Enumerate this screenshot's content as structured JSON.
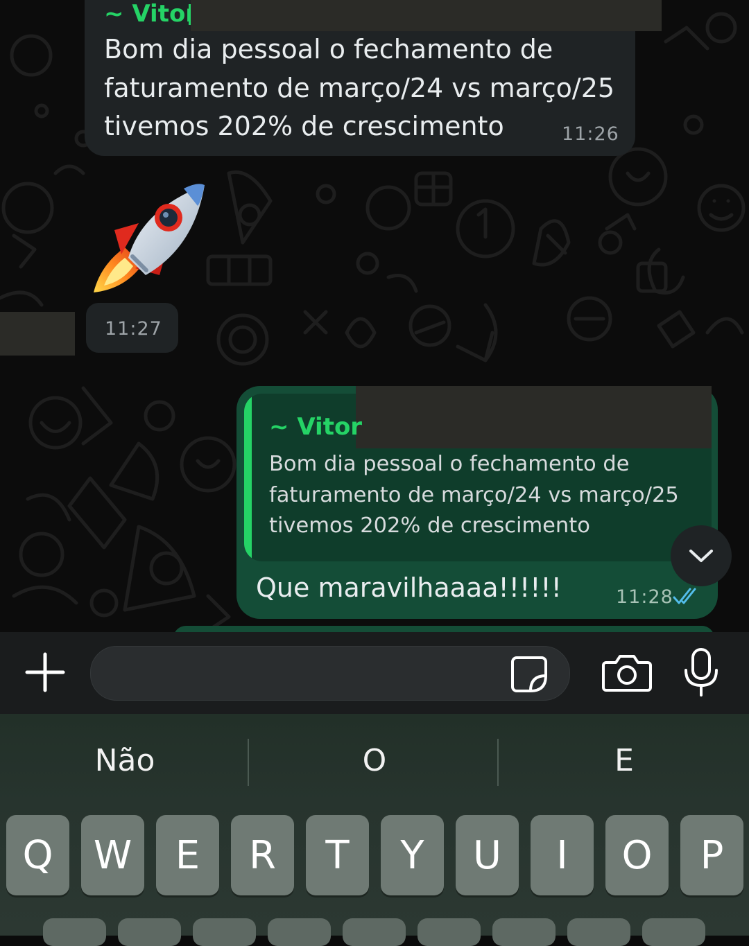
{
  "messages": {
    "incoming": {
      "sender": "~ Vitor",
      "text": "Bom dia pessoal o fechamento de faturamento de março/24 vs março/25 tivemos 202% de crescimento",
      "time": "11:26"
    },
    "sticker": {
      "icon": "rocket-icon",
      "time": "11:27"
    },
    "outgoing": {
      "quoted_sender": "~ Vitor",
      "quoted_text": "Bom dia pessoal o fechamento de faturamento de março/24 vs março/25 tivemos 202% de crescimento",
      "text": "Que maravilhaaaa!!!!!!",
      "time": "11:28",
      "status": "read"
    }
  },
  "input": {
    "placeholder": "",
    "value": ""
  },
  "keyboard": {
    "suggestions": [
      "Não",
      "O",
      "E"
    ],
    "row1": [
      "Q",
      "W",
      "E",
      "R",
      "T",
      "Y",
      "U",
      "I",
      "O",
      "P"
    ]
  },
  "colors": {
    "accent": "#25d366",
    "incoming_bubble": "#1f2325",
    "outgoing_bubble": "#144d37",
    "read_ticks": "#53bdeb"
  }
}
